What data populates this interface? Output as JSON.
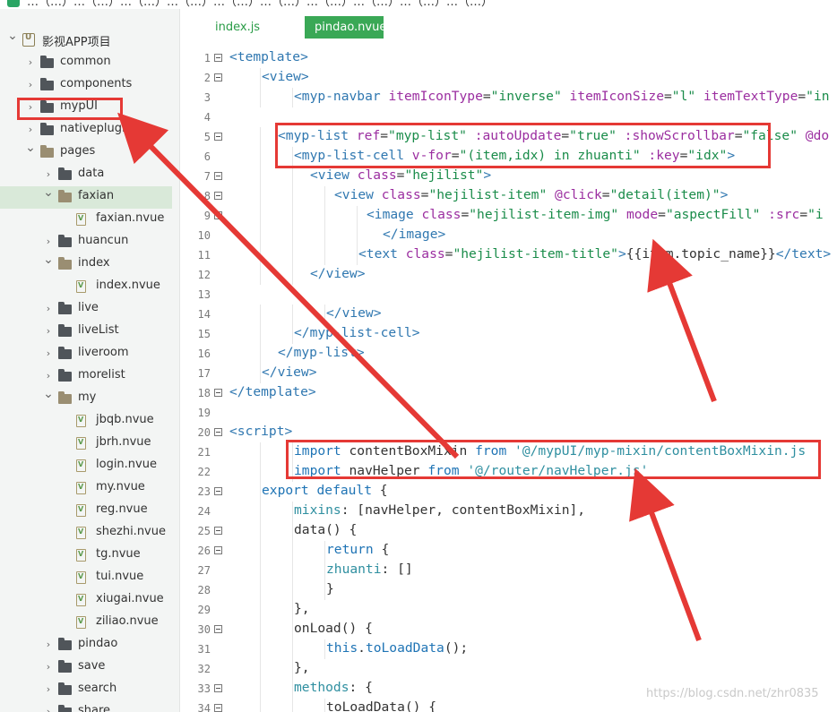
{
  "top_strip_text": "…（…）…（…）…（…）…（…）…（…）…（…）…（…）…（…）…（…）…（…）",
  "explorer": {
    "items": [
      {
        "name": "影视APP项目",
        "kind": "project",
        "depth": 0,
        "expanded": true
      },
      {
        "name": "common",
        "kind": "folder",
        "depth": 1
      },
      {
        "name": "components",
        "kind": "folder",
        "depth": 1
      },
      {
        "name": "mypUI",
        "kind": "folder",
        "depth": 1
      },
      {
        "name": "nativeplugins",
        "kind": "folder",
        "depth": 1
      },
      {
        "name": "pages",
        "kind": "folder",
        "depth": 1,
        "expanded": true
      },
      {
        "name": "data",
        "kind": "folder",
        "depth": 2
      },
      {
        "name": "faxian",
        "kind": "folder",
        "depth": 2,
        "expanded": true,
        "selected": true
      },
      {
        "name": "faxian.nvue",
        "kind": "file",
        "depth": 3
      },
      {
        "name": "huancun",
        "kind": "folder",
        "depth": 2
      },
      {
        "name": "index",
        "kind": "folder",
        "depth": 2,
        "expanded": true
      },
      {
        "name": "index.nvue",
        "kind": "file",
        "depth": 3
      },
      {
        "name": "live",
        "kind": "folder",
        "depth": 2
      },
      {
        "name": "liveList",
        "kind": "folder",
        "depth": 2
      },
      {
        "name": "liveroom",
        "kind": "folder",
        "depth": 2
      },
      {
        "name": "morelist",
        "kind": "folder",
        "depth": 2
      },
      {
        "name": "my",
        "kind": "folder",
        "depth": 2,
        "expanded": true
      },
      {
        "name": "jbqb.nvue",
        "kind": "file",
        "depth": 3
      },
      {
        "name": "jbrh.nvue",
        "kind": "file",
        "depth": 3
      },
      {
        "name": "login.nvue",
        "kind": "file",
        "depth": 3
      },
      {
        "name": "my.nvue",
        "kind": "file",
        "depth": 3
      },
      {
        "name": "reg.nvue",
        "kind": "file",
        "depth": 3
      },
      {
        "name": "shezhi.nvue",
        "kind": "file",
        "depth": 3
      },
      {
        "name": "tg.nvue",
        "kind": "file",
        "depth": 3
      },
      {
        "name": "tui.nvue",
        "kind": "file",
        "depth": 3
      },
      {
        "name": "xiugai.nvue",
        "kind": "file",
        "depth": 3
      },
      {
        "name": "ziliao.nvue",
        "kind": "file",
        "depth": 3
      },
      {
        "name": "pindao",
        "kind": "folder",
        "depth": 2
      },
      {
        "name": "save",
        "kind": "folder",
        "depth": 2
      },
      {
        "name": "search",
        "kind": "folder",
        "depth": 2
      },
      {
        "name": "share",
        "kind": "folder",
        "depth": 2
      }
    ]
  },
  "tabs": [
    {
      "label": "index.js",
      "active": false
    },
    {
      "label": "pindao.nvue",
      "active": true
    }
  ],
  "editor": {
    "lines": [
      {
        "n": 1,
        "fold": true,
        "indent": 0,
        "tokens": [
          [
            "tag",
            "<template>"
          ]
        ]
      },
      {
        "n": 2,
        "fold": true,
        "indent": 1,
        "tokens": [
          [
            "tag",
            "<view>"
          ]
        ]
      },
      {
        "n": 3,
        "fold": false,
        "indent": 2,
        "tokens": [
          [
            "tag",
            "<myp-navbar "
          ],
          [
            "attr",
            "itemIconType"
          ],
          [
            "text",
            "="
          ],
          [
            "str",
            "\"inverse\""
          ],
          [
            "text",
            " "
          ],
          [
            "attr",
            "itemIconSize"
          ],
          [
            "text",
            "="
          ],
          [
            "str",
            "\"l\""
          ],
          [
            "text",
            " "
          ],
          [
            "attr",
            "itemTextType"
          ],
          [
            "text",
            "="
          ],
          [
            "str",
            "\"in"
          ]
        ]
      },
      {
        "n": 4,
        "fold": false,
        "indent": 0,
        "tokens": []
      },
      {
        "n": 5,
        "fold": true,
        "indent": 1.5,
        "tokens": [
          [
            "tag",
            "<myp-list "
          ],
          [
            "attr",
            "ref"
          ],
          [
            "text",
            "="
          ],
          [
            "str",
            "\"myp-list\""
          ],
          [
            "text",
            " "
          ],
          [
            "attr",
            ":autoUpdate"
          ],
          [
            "text",
            "="
          ],
          [
            "str",
            "\"true\""
          ],
          [
            "text",
            " "
          ],
          [
            "attr",
            ":showScrollbar"
          ],
          [
            "text",
            "="
          ],
          [
            "str",
            "\"false\""
          ],
          [
            "text",
            " "
          ],
          [
            "attr",
            "@do"
          ]
        ]
      },
      {
        "n": 6,
        "fold": false,
        "indent": 2,
        "tokens": [
          [
            "tag",
            "<myp-list-cell "
          ],
          [
            "attr",
            "v-for"
          ],
          [
            "text",
            "="
          ],
          [
            "str",
            "\"(item,idx) in zhuanti\""
          ],
          [
            "text",
            " "
          ],
          [
            "attr",
            ":key"
          ],
          [
            "text",
            "="
          ],
          [
            "str",
            "\"idx\""
          ],
          [
            "tag",
            ">"
          ]
        ]
      },
      {
        "n": 7,
        "fold": true,
        "indent": 2.5,
        "tokens": [
          [
            "tag",
            "<view "
          ],
          [
            "attr",
            "class"
          ],
          [
            "text",
            "="
          ],
          [
            "str",
            "\"hejilist\""
          ],
          [
            "tag",
            ">"
          ]
        ]
      },
      {
        "n": 8,
        "fold": true,
        "indent": 3.25,
        "tokens": [
          [
            "tag",
            "<view "
          ],
          [
            "attr",
            "class"
          ],
          [
            "text",
            "="
          ],
          [
            "str",
            "\"hejilist-item\""
          ],
          [
            "text",
            " "
          ],
          [
            "attr",
            "@click"
          ],
          [
            "text",
            "="
          ],
          [
            "str",
            "\"detail(item)\""
          ],
          [
            "tag",
            ">"
          ]
        ]
      },
      {
        "n": 9,
        "fold": true,
        "indent": 4.25,
        "tokens": [
          [
            "tag",
            "<image "
          ],
          [
            "attr",
            "class"
          ],
          [
            "text",
            "="
          ],
          [
            "str",
            "\"hejilist-item-img\""
          ],
          [
            "text",
            " "
          ],
          [
            "attr",
            "mode"
          ],
          [
            "text",
            "="
          ],
          [
            "str",
            "\"aspectFill\""
          ],
          [
            "text",
            " "
          ],
          [
            "attr",
            ":src"
          ],
          [
            "text",
            "="
          ],
          [
            "str",
            "\"i"
          ]
        ]
      },
      {
        "n": 10,
        "fold": false,
        "indent": 4.75,
        "tokens": [
          [
            "tag",
            "</image>"
          ]
        ]
      },
      {
        "n": 11,
        "fold": false,
        "indent": 4,
        "tokens": [
          [
            "tag",
            "<text "
          ],
          [
            "attr",
            "class"
          ],
          [
            "text",
            "="
          ],
          [
            "str",
            "\"hejilist-item-title\""
          ],
          [
            "tag",
            ">"
          ],
          [
            "text",
            "{{item.topic_name}}"
          ],
          [
            "tag",
            "</text>"
          ]
        ]
      },
      {
        "n": 12,
        "fold": false,
        "indent": 2.5,
        "tokens": [
          [
            "tag",
            "</view>"
          ]
        ]
      },
      {
        "n": 13,
        "fold": false,
        "indent": 0,
        "tokens": []
      },
      {
        "n": 14,
        "fold": false,
        "indent": 3,
        "tokens": [
          [
            "tag",
            "</view>"
          ]
        ]
      },
      {
        "n": 15,
        "fold": false,
        "indent": 2,
        "tokens": [
          [
            "tag",
            "</myp-list-cell>"
          ]
        ]
      },
      {
        "n": 16,
        "fold": false,
        "indent": 1.5,
        "tokens": [
          [
            "tag",
            "</myp-list>"
          ]
        ]
      },
      {
        "n": 17,
        "fold": false,
        "indent": 1,
        "tokens": [
          [
            "tag",
            "</view>"
          ]
        ]
      },
      {
        "n": 18,
        "fold": true,
        "indent": 0,
        "tokens": [
          [
            "tag",
            "</template>"
          ]
        ]
      },
      {
        "n": 19,
        "fold": false,
        "indent": 0,
        "tokens": []
      },
      {
        "n": 20,
        "fold": true,
        "indent": 0,
        "tokens": [
          [
            "tag",
            "<script>"
          ]
        ]
      },
      {
        "n": 21,
        "fold": false,
        "indent": 2,
        "tokens": [
          [
            "kw",
            "import "
          ],
          [
            "text",
            "contentBoxMixin "
          ],
          [
            "kw",
            "from "
          ],
          [
            "str2",
            "'@/mypUI/myp-mixin/contentBoxMixin.js"
          ]
        ]
      },
      {
        "n": 22,
        "fold": false,
        "indent": 2,
        "tokens": [
          [
            "kw",
            "import "
          ],
          [
            "text",
            "navHelper "
          ],
          [
            "kw",
            "from "
          ],
          [
            "str2",
            "'@/router/navHelper.js'"
          ]
        ]
      },
      {
        "n": 23,
        "fold": true,
        "indent": 1,
        "tokens": [
          [
            "kw",
            "export default "
          ],
          [
            "text",
            "{"
          ]
        ]
      },
      {
        "n": 24,
        "fold": false,
        "indent": 2,
        "tokens": [
          [
            "str2",
            "mixins"
          ],
          [
            "text",
            ": [navHelper, contentBoxMixin],"
          ]
        ]
      },
      {
        "n": 25,
        "fold": true,
        "indent": 2,
        "tokens": [
          [
            "text",
            "data() {"
          ]
        ]
      },
      {
        "n": 26,
        "fold": true,
        "indent": 3,
        "tokens": [
          [
            "kw",
            "return "
          ],
          [
            "text",
            "{"
          ]
        ]
      },
      {
        "n": 27,
        "fold": false,
        "indent": 3,
        "tokens": [
          [
            "str2",
            "zhuanti"
          ],
          [
            "text",
            ": []"
          ]
        ]
      },
      {
        "n": 28,
        "fold": false,
        "indent": 3,
        "tokens": [
          [
            "text",
            "}"
          ]
        ]
      },
      {
        "n": 29,
        "fold": false,
        "indent": 2,
        "tokens": [
          [
            "text",
            "},"
          ]
        ]
      },
      {
        "n": 30,
        "fold": true,
        "indent": 2,
        "tokens": [
          [
            "text",
            "onLoad() {"
          ]
        ]
      },
      {
        "n": 31,
        "fold": false,
        "indent": 3,
        "tokens": [
          [
            "kw",
            "this"
          ],
          [
            "text",
            "."
          ],
          [
            "kw",
            "toLoadData"
          ],
          [
            "text",
            "();"
          ]
        ]
      },
      {
        "n": 32,
        "fold": false,
        "indent": 2,
        "tokens": [
          [
            "text",
            "},"
          ]
        ]
      },
      {
        "n": 33,
        "fold": true,
        "indent": 2,
        "tokens": [
          [
            "str2",
            "methods"
          ],
          [
            "text",
            ": {"
          ]
        ]
      },
      {
        "n": 34,
        "fold": true,
        "indent": 3,
        "tokens": [
          [
            "text",
            "toLoadData() {"
          ]
        ]
      }
    ]
  },
  "watermark": "https://blog.csdn.net/zhr0835"
}
